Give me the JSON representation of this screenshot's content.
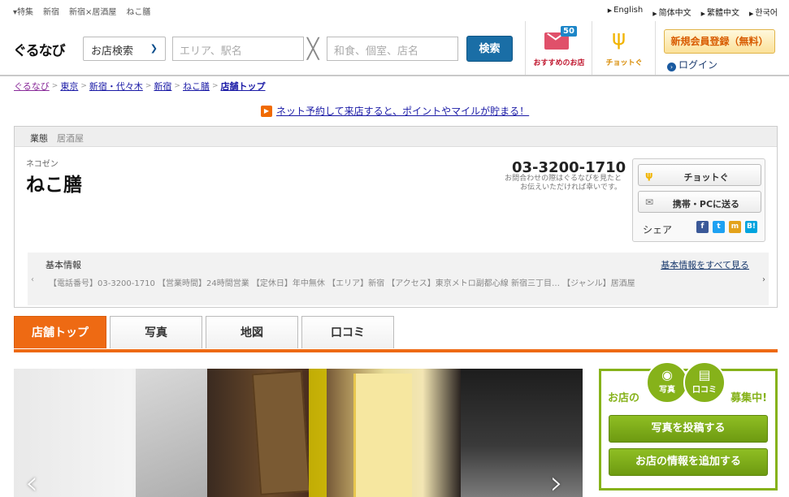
{
  "topstrip": {
    "crumbs": [
      "▾特集",
      "新宿",
      "新宿×居酒屋",
      "ねこ膳"
    ],
    "langs": [
      "English",
      "简体中文",
      "繁體中文",
      "한국어"
    ]
  },
  "header": {
    "logo": "ぐるなび",
    "search_select": "お店検索",
    "area_placeholder": "エリア、駅名",
    "keyword_placeholder": "和食、個室、店名",
    "search_button": "検索",
    "mail_badge": "50",
    "mail_label": "おすすめのお店",
    "chotto_label": "チョットぐ",
    "register_button": "新規会員登録（無料）",
    "login": "ログイン"
  },
  "breadcrumb": [
    "ぐるなび",
    "東京",
    "新宿・代々木",
    "新宿",
    "ねこ膳",
    "店舗トップ"
  ],
  "promo": "ネット予約して来店すると、ポイントやマイルが貯まる！",
  "shop": {
    "tag1": "業態",
    "tag2": "居酒屋",
    "kana": "ネコゼン",
    "name": "ねこ膳",
    "tel": "03-3200-1710",
    "tel_note_1": "お問合わせの際はぐるなびを見たと",
    "tel_note_2": "お伝えいただければ幸いです。",
    "chotto_btn": "チョットぐ",
    "send_btn": "携帯・PCに送る",
    "share": "シェア",
    "share_icons": [
      "f",
      "t",
      "m",
      "B!"
    ],
    "info_label": "基本情報",
    "info_all": "基本情報をすべて見る",
    "info_line": "【電話番号】03-3200-1710 【営業時間】24時間営業 【定休日】年中無休 【エリア】新宿 【アクセス】東京メトロ副都心線 新宿三丁目… 【ジャンル】居酒屋"
  },
  "tabs": [
    "店舗トップ",
    "写真",
    "地図",
    "口コミ"
  ],
  "recruit": {
    "left": "お店の",
    "right": "募集中!",
    "photo_badge": "写真",
    "review_badge": "口コミ",
    "btn1": "写真を投稿する",
    "btn2": "お店の情報を追加する"
  }
}
